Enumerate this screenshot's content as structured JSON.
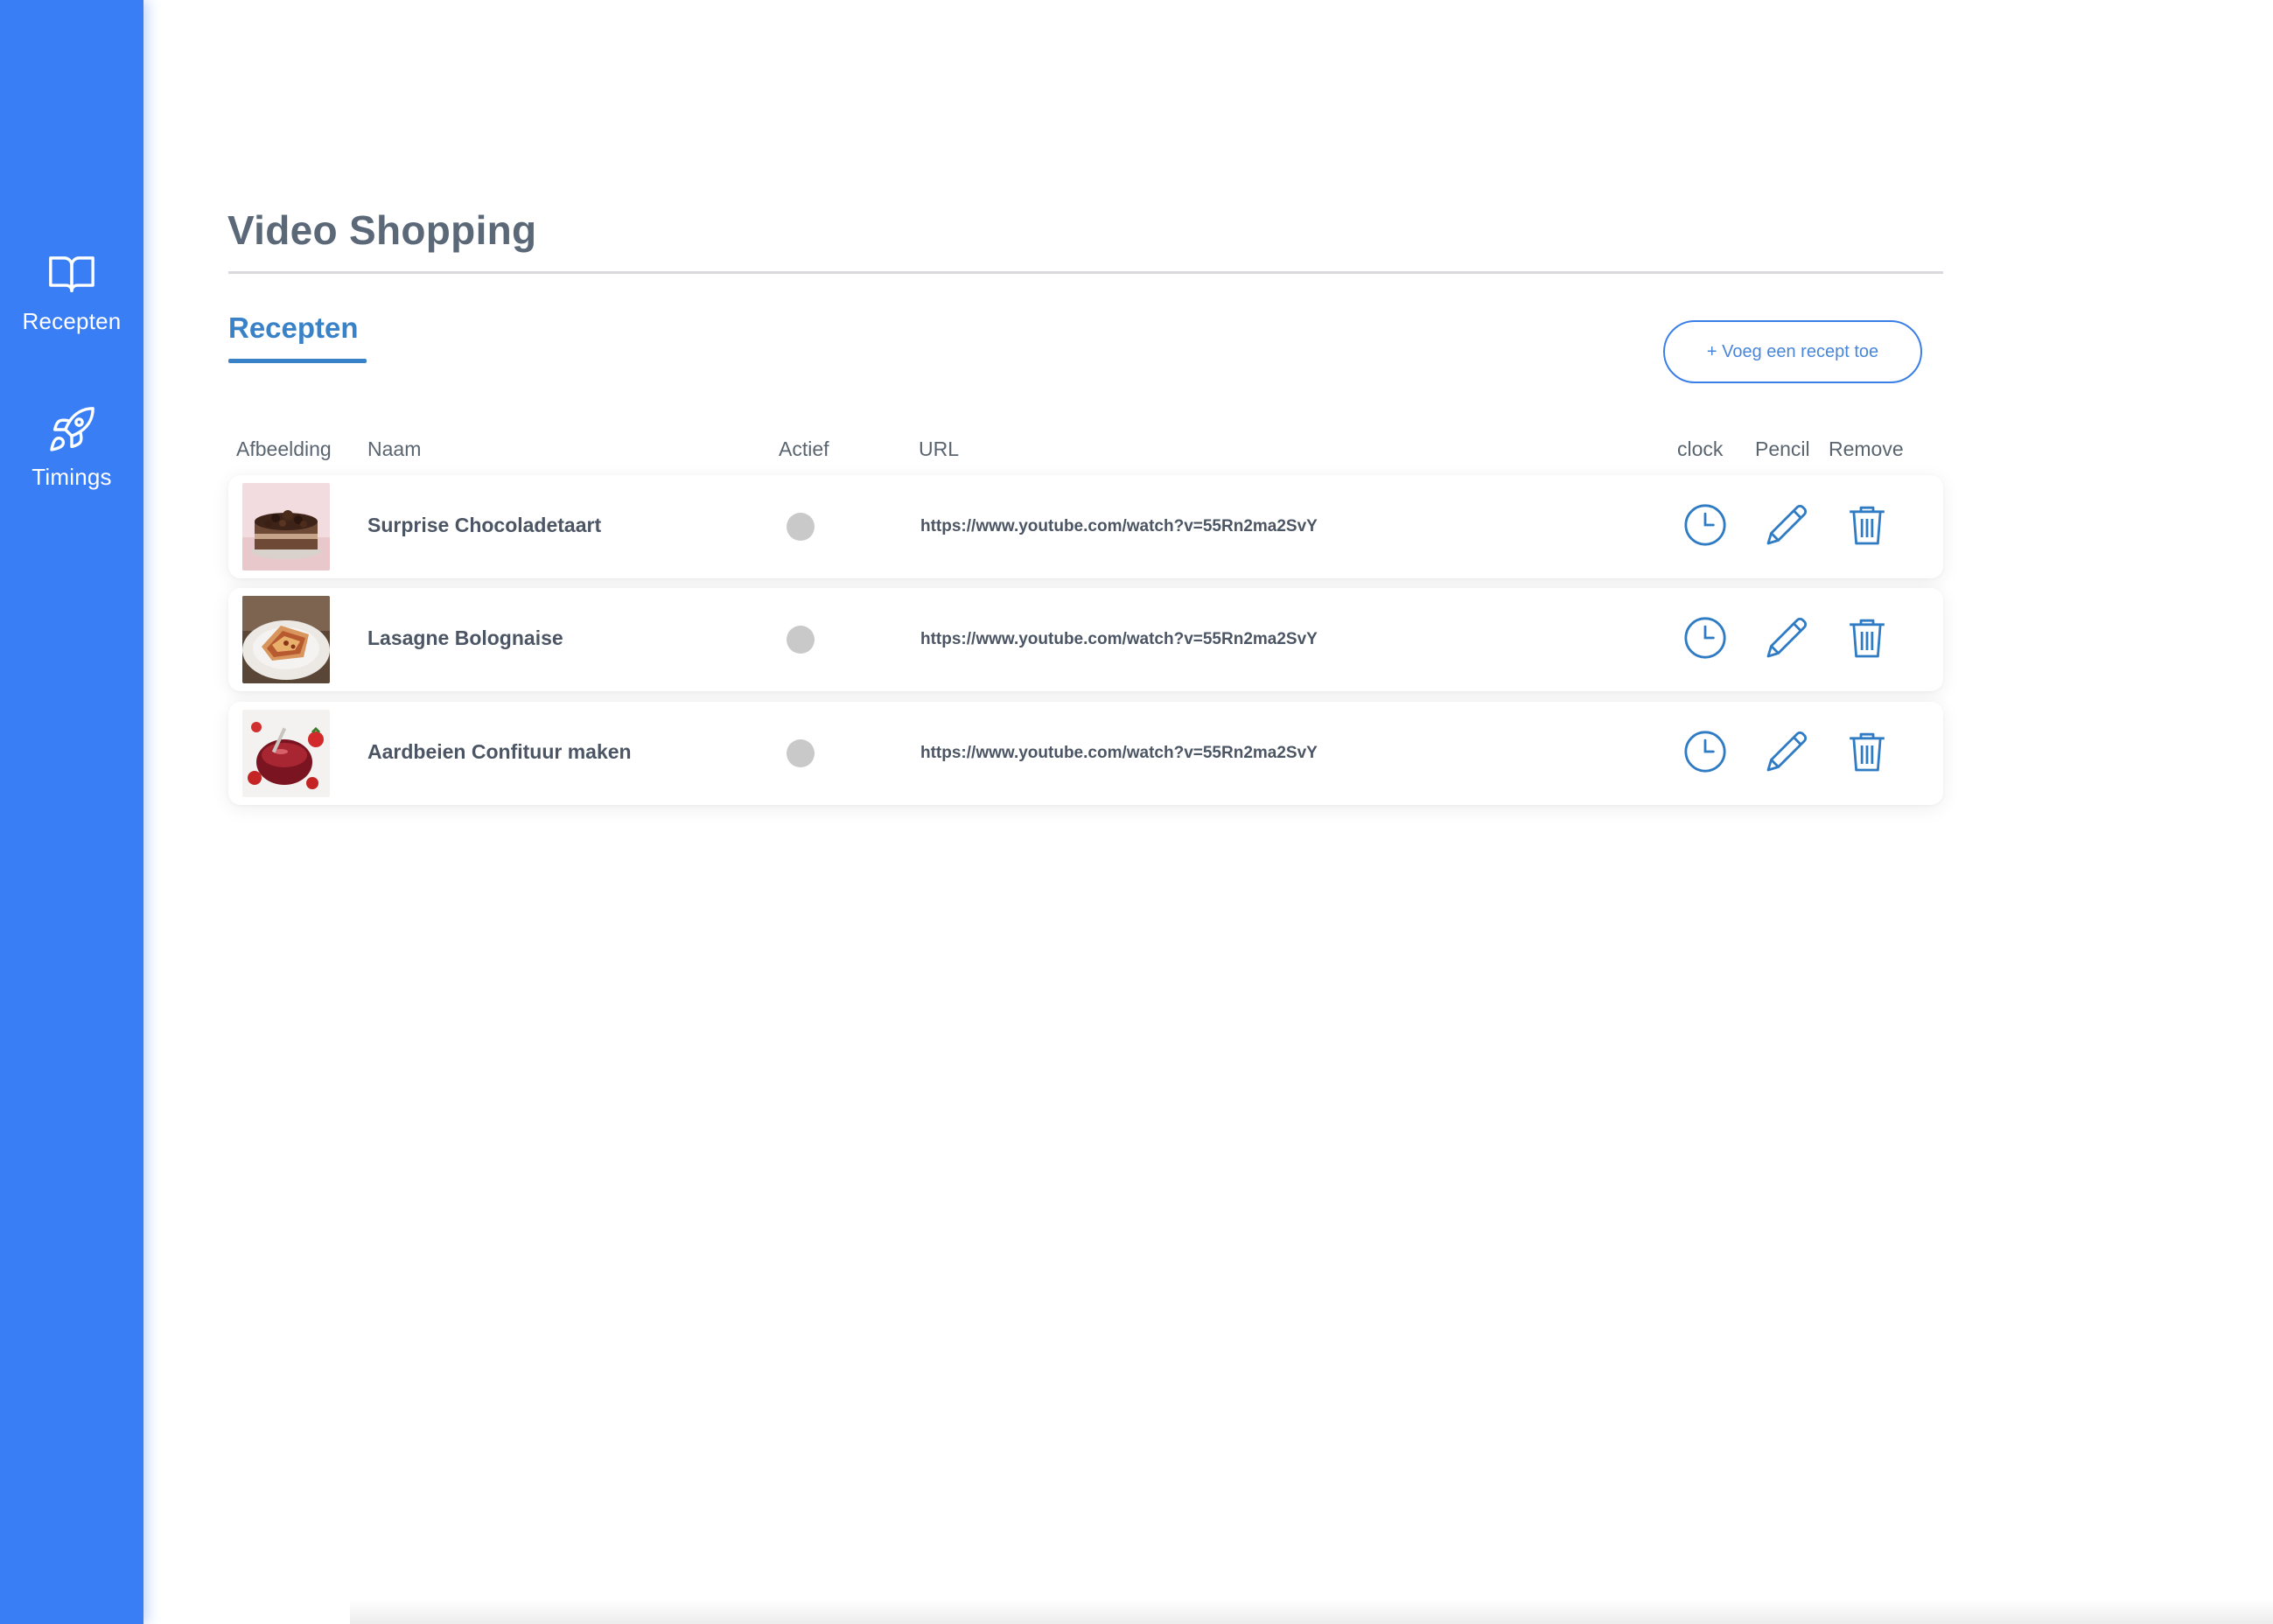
{
  "sidebar": {
    "items": [
      {
        "label": "Recepten",
        "icon": "book-icon"
      },
      {
        "label": "Timings",
        "icon": "rocket-icon"
      }
    ],
    "color": "#3a7ef6"
  },
  "page": {
    "title": "Video Shopping",
    "active_tab": "Recepten",
    "add_button": "+ Voeg een recept toe",
    "accent_color": "#3a82c8"
  },
  "table": {
    "headers": {
      "afbeelding": "Afbeelding",
      "naam": "Naam",
      "actief": "Actief",
      "url": "URL",
      "clock": "clock",
      "pencil": "Pencil",
      "remove": "Remove"
    },
    "rows": [
      {
        "naam": "Surprise Chocoladetaart",
        "url": "https://www.youtube.com/watch?v=55Rn2ma2SvY",
        "actief": false,
        "thumb": "chocolate-cake-image"
      },
      {
        "naam": "Lasagne Bolognaise",
        "url": "https://www.youtube.com/watch?v=55Rn2ma2SvY",
        "actief": false,
        "thumb": "lasagne-image"
      },
      {
        "naam": "Aardbeien Confituur maken",
        "url": "https://www.youtube.com/watch?v=55Rn2ma2SvY",
        "actief": false,
        "thumb": "strawberry-jam-image"
      }
    ],
    "action_icons": [
      "clock-icon",
      "pencil-icon",
      "trash-icon"
    ]
  }
}
